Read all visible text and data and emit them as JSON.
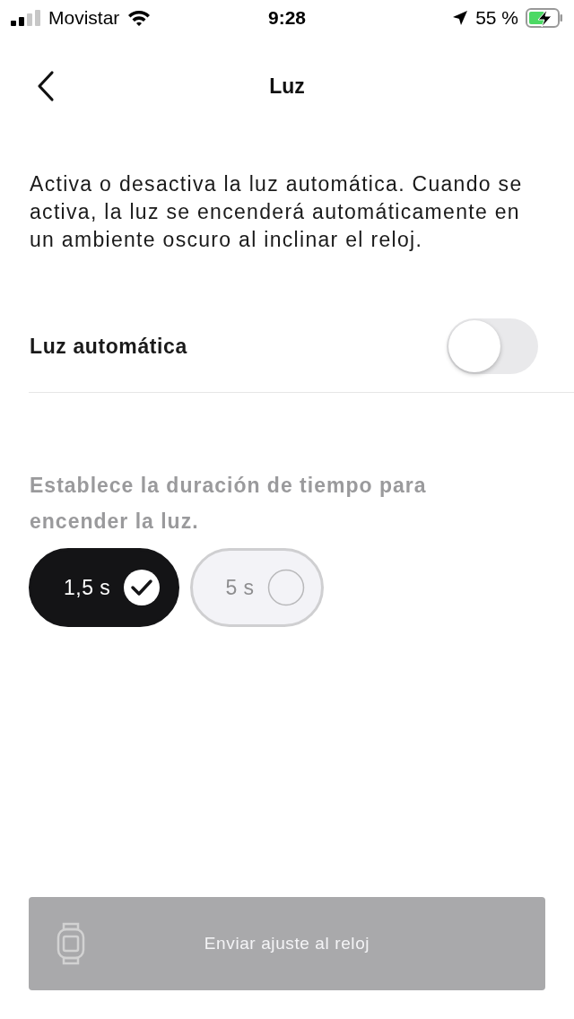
{
  "status_bar": {
    "carrier": "Movistar",
    "time": "9:28",
    "battery_percent": "55 %",
    "charging": true
  },
  "header": {
    "title": "Luz"
  },
  "description": "Activa o desactiva la luz automática. Cuando se activa, la luz se encenderá automáticamente en un ambiente oscuro al inclinar el reloj.",
  "auto_light": {
    "label": "Luz automática",
    "on": false
  },
  "duration": {
    "label": "Establece la duración de tiempo para encender la luz.",
    "disabled": true,
    "options": [
      {
        "label": "1,5 s",
        "selected": true
      },
      {
        "label": "5 s",
        "selected": false
      }
    ]
  },
  "send_button": {
    "label": "Enviar ajuste al reloj",
    "disabled": true
  }
}
